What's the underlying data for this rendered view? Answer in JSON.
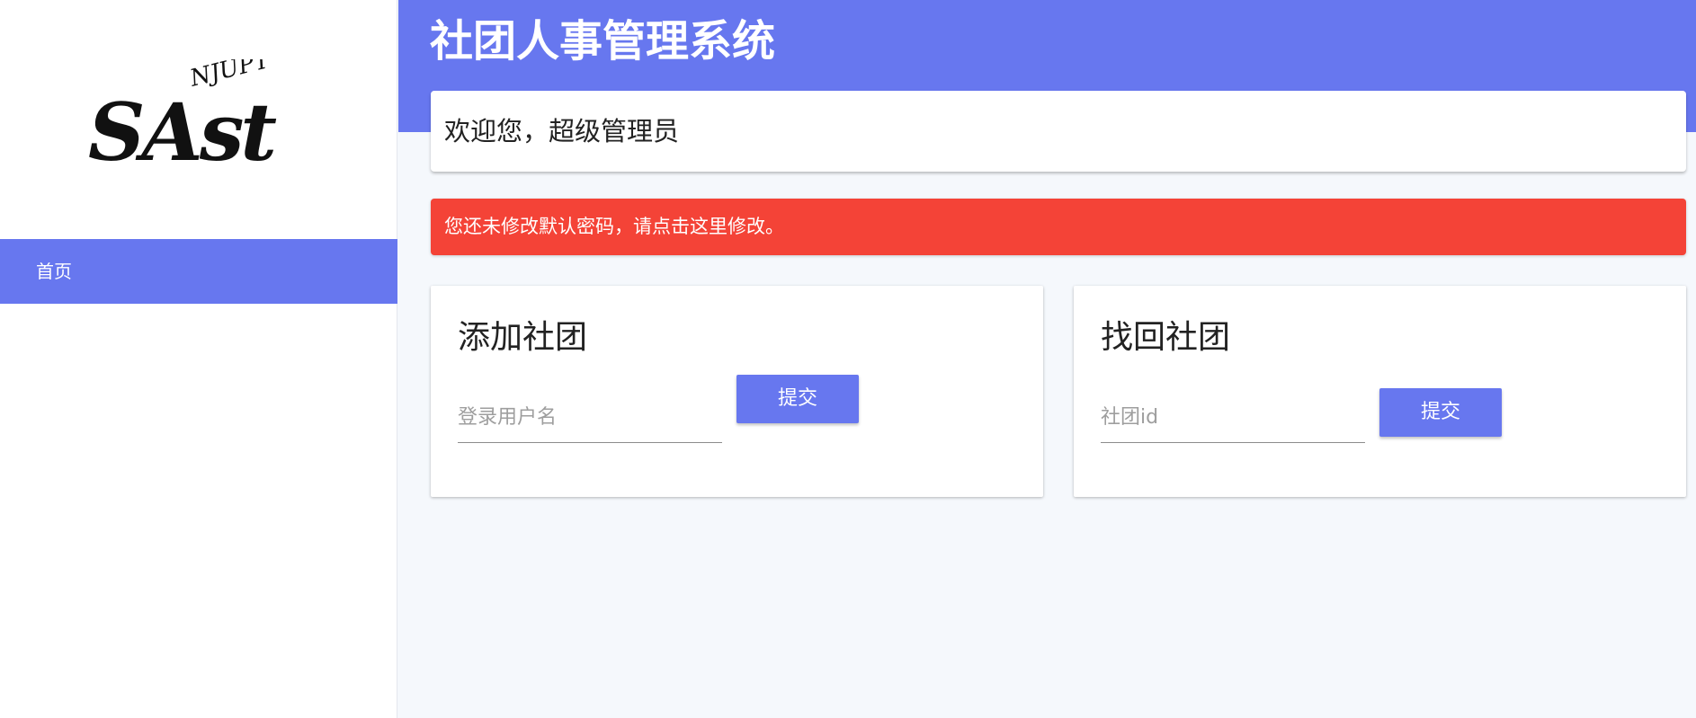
{
  "app": {
    "title": "社团人事管理系统"
  },
  "sidebar": {
    "logo_text": "SAst",
    "logo_subtext": "NJUPT",
    "items": [
      {
        "label": "首页",
        "active": true
      }
    ]
  },
  "welcome": {
    "text": "欢迎您，超级管理员"
  },
  "alert": {
    "text": "您还未修改默认密码，请点击这里修改。"
  },
  "cards": {
    "add_club": {
      "title": "添加社团",
      "input_placeholder": "登录用户名",
      "input_value": "",
      "button_label": "提交"
    },
    "recover_club": {
      "title": "找回社团",
      "input_placeholder": "社团id",
      "input_value": "",
      "button_label": "提交"
    }
  },
  "colors": {
    "accent": "#6777ef",
    "alert": "#f44337",
    "background": "#f5f8fc"
  }
}
